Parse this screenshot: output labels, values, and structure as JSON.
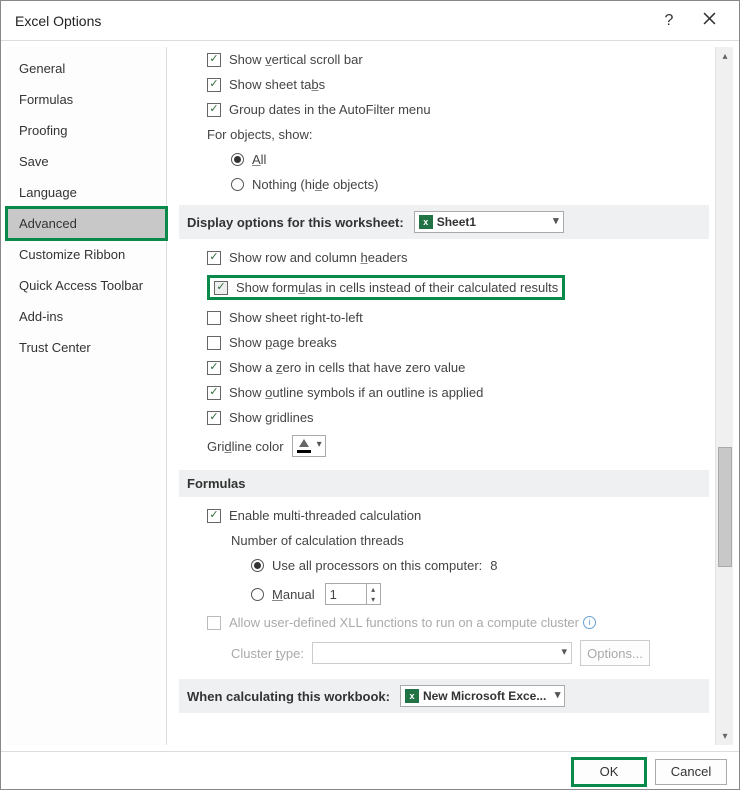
{
  "window": {
    "title": "Excel Options"
  },
  "sidebar": {
    "items": [
      {
        "label": "General"
      },
      {
        "label": "Formulas"
      },
      {
        "label": "Proofing"
      },
      {
        "label": "Save"
      },
      {
        "label": "Language"
      },
      {
        "label": "Advanced",
        "selected": true
      },
      {
        "label": "Customize Ribbon"
      },
      {
        "label": "Quick Access Toolbar"
      },
      {
        "label": "Add-ins"
      },
      {
        "label": "Trust Center"
      }
    ]
  },
  "top_checks": {
    "vscroll": "Show vertical scroll bar",
    "tabs": "Show sheet tabs",
    "group_dates": "Group dates in the AutoFilter menu",
    "for_objects": "For objects, show:",
    "all": "All",
    "nothing": "Nothing (hide objects)"
  },
  "worksheet_section": {
    "header": "Display options for this worksheet:",
    "sheet": "Sheet1",
    "show_headers": "Show row and column headers",
    "show_formulas": "Show formulas in cells instead of their calculated results",
    "rtl": "Show sheet right-to-left",
    "page_breaks": "Show page breaks",
    "zero": "Show a zero in cells that have zero value",
    "outline": "Show outline symbols if an outline is applied",
    "gridlines": "Show gridlines",
    "gridline_color": "Gridline color"
  },
  "formulas_section": {
    "header": "Formulas",
    "multithread": "Enable multi-threaded calculation",
    "threads_label": "Number of calculation threads",
    "all_proc": "Use all processors on this computer:",
    "proc_count": "8",
    "manual": "Manual",
    "manual_val": "1",
    "xll": "Allow user-defined XLL functions to run on a compute cluster",
    "cluster_type": "Cluster type:",
    "options_btn": "Options..."
  },
  "workbook_section": {
    "header": "When calculating this workbook:",
    "book": "New Microsoft Exce..."
  },
  "footer": {
    "ok": "OK",
    "cancel": "Cancel"
  }
}
